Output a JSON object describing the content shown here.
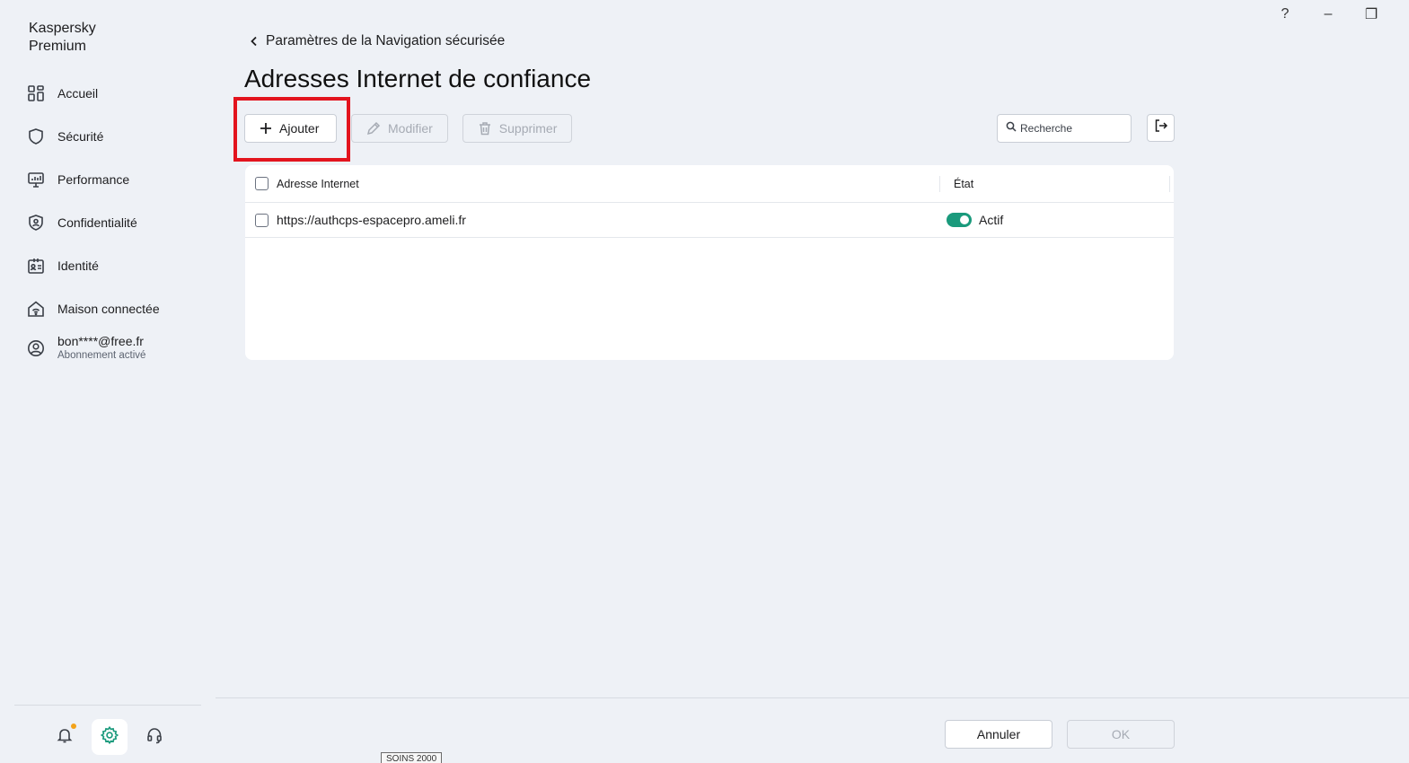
{
  "app": {
    "title": "Kaspersky\nPremium"
  },
  "window_controls": {
    "help": "?",
    "minimize": "–",
    "restore": "❐"
  },
  "sidebar": {
    "items": [
      {
        "label": "Accueil",
        "icon": "grid-icon"
      },
      {
        "label": "Sécurité",
        "icon": "shield-icon"
      },
      {
        "label": "Performance",
        "icon": "monitor-icon"
      },
      {
        "label": "Confidentialité",
        "icon": "privacy-shield-icon"
      },
      {
        "label": "Identité",
        "icon": "id-card-icon"
      },
      {
        "label": "Maison connectée",
        "icon": "smart-home-icon"
      }
    ],
    "account": {
      "email": "bon****@free.fr",
      "status": "Abonnement activé",
      "icon": "user-circle-icon"
    },
    "bottom": {
      "notifications_icon": "bell-icon",
      "settings_icon": "gear-icon",
      "support_icon": "headset-icon",
      "notification_dot_color": "#f3a31a"
    }
  },
  "header": {
    "breadcrumb": "Paramètres de la Navigation sécurisée",
    "title": "Adresses Internet de confiance"
  },
  "toolbar": {
    "add_label": "Ajouter",
    "edit_label": "Modifier",
    "delete_label": "Supprimer",
    "search_placeholder": "Recherche"
  },
  "table": {
    "columns": [
      "Adresse Internet",
      "État"
    ],
    "rows": [
      {
        "address": "https://authcps-espacepro.ameli.fr",
        "state": "Actif",
        "enabled": true
      }
    ]
  },
  "footer": {
    "cancel_label": "Annuler",
    "ok_label": "OK"
  },
  "tooltip": "SOINS 2000",
  "colors": {
    "accent": "#1a9a7c",
    "highlight": "#e3141e"
  }
}
